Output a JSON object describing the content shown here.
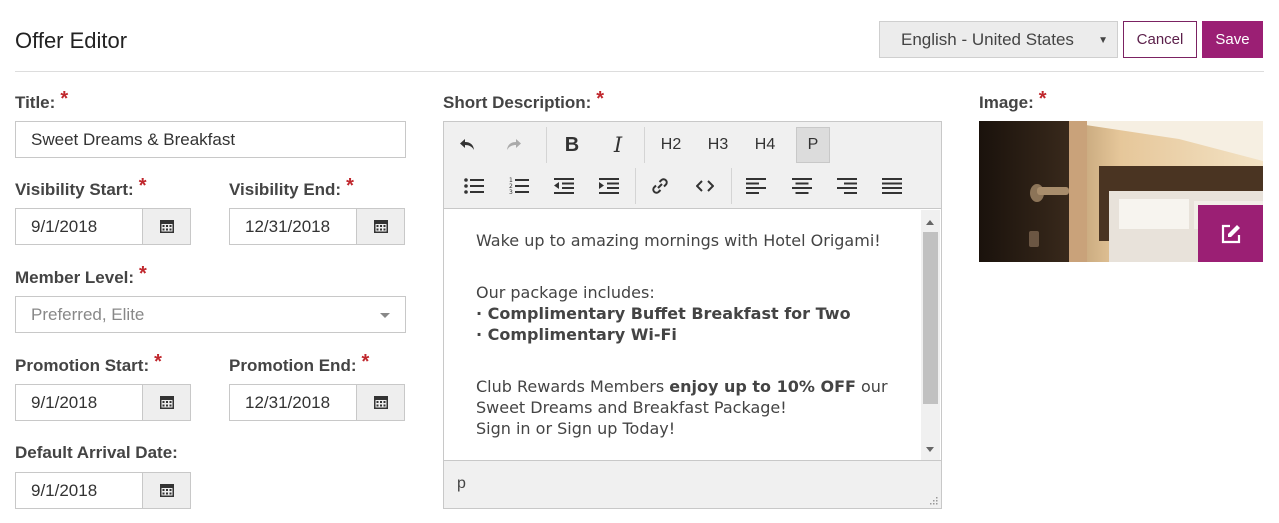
{
  "header": {
    "title": "Offer Editor",
    "language": "English - United States",
    "cancel_label": "Cancel",
    "save_label": "Save"
  },
  "form": {
    "title_label": "Title:",
    "title_value": "Sweet Dreams & Breakfast",
    "visibility_start_label": "Visibility Start:",
    "visibility_start_value": "9/1/2018",
    "visibility_end_label": "Visibility End:",
    "visibility_end_value": "12/31/2018",
    "member_level_label": "Member Level:",
    "member_level_value": "Preferred, Elite",
    "promotion_start_label": "Promotion Start:",
    "promotion_start_value": "9/1/2018",
    "promotion_end_label": "Promotion End:",
    "promotion_end_value": "12/31/2018",
    "default_arrival_label": "Default Arrival Date:",
    "default_arrival_value": "9/1/2018",
    "required_mark": "*"
  },
  "editor": {
    "label": "Short Description:",
    "toolbar": {
      "h2": "H2",
      "h3": "H3",
      "h4": "H4",
      "p": "P",
      "bold": "B",
      "italic": "I"
    },
    "content": {
      "line1": "Wake up to amazing mornings with Hotel Origami!",
      "line2": "Our package includes:",
      "bullet1": "· Complimentary Buffet Breakfast for Two",
      "bullet2": "· Complimentary Wi-Fi",
      "line3_a": "Club Rewards Members ",
      "line3_b": "enjoy up to 10% OFF",
      "line3_c": " our",
      "line4": "Sweet Dreams and Breakfast Package!",
      "line5": "Sign in or Sign up Today!"
    },
    "status_path": "p"
  },
  "image": {
    "label": "Image:"
  },
  "colors": {
    "brand": "#9b1f74",
    "required": "#c0272d"
  }
}
